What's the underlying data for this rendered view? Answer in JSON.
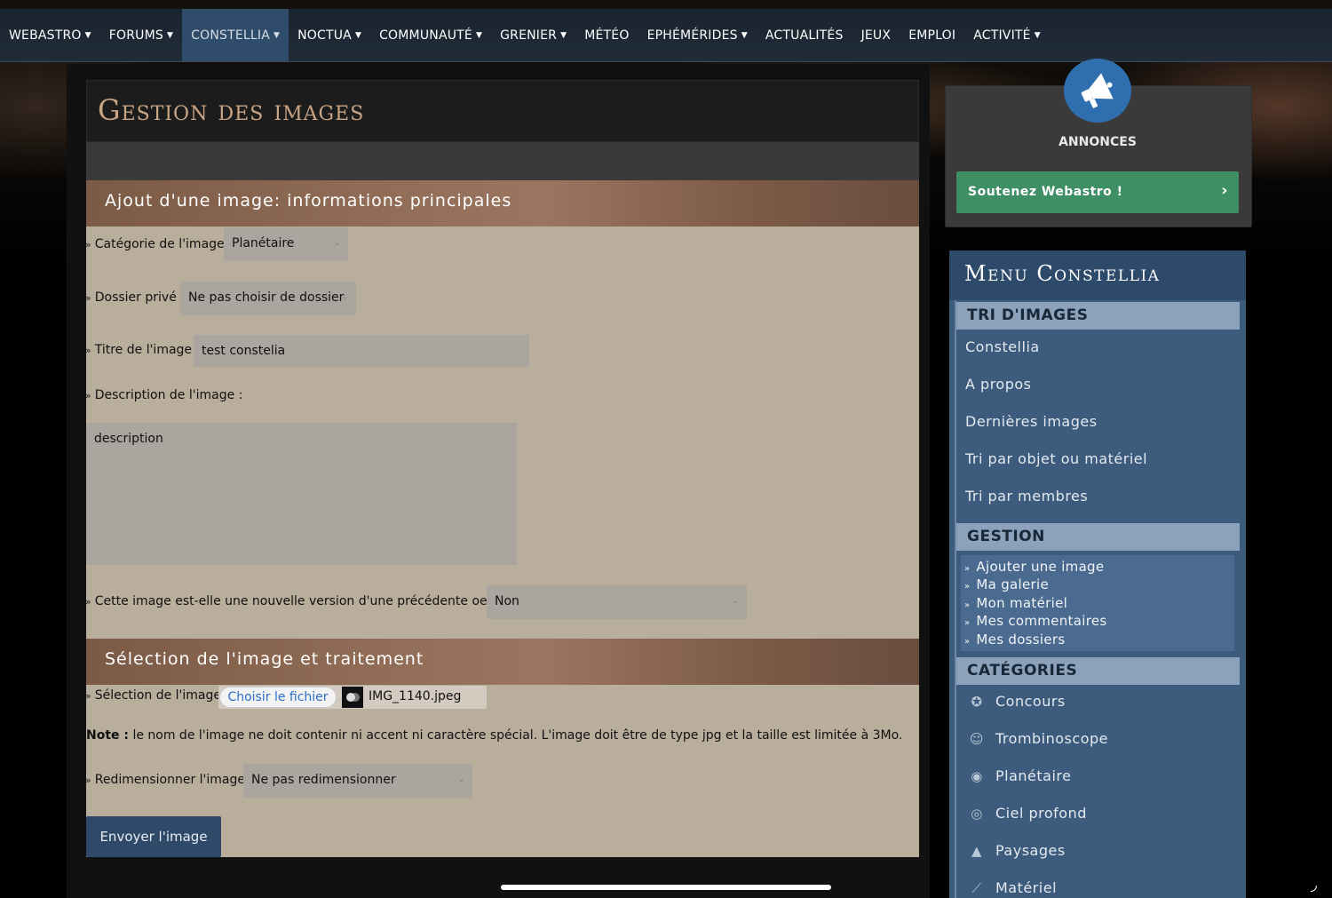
{
  "nav": {
    "items": [
      {
        "label": "WEBASTRO",
        "caret": true
      },
      {
        "label": "FORUMS",
        "caret": true
      },
      {
        "label": "CONSTELLIA",
        "caret": true,
        "active": true
      },
      {
        "label": "NOCTUA",
        "caret": true
      },
      {
        "label": "COMMUNAUTÉ",
        "caret": true
      },
      {
        "label": "GRENIER",
        "caret": true
      },
      {
        "label": "MÉTÉO",
        "caret": false
      },
      {
        "label": "EPHÉMÉRIDES",
        "caret": true
      },
      {
        "label": "ACTUALITÉS",
        "caret": false
      },
      {
        "label": "JEUX",
        "caret": false
      },
      {
        "label": "EMPLOI",
        "caret": false
      },
      {
        "label": "ACTIVITÉ",
        "caret": true
      }
    ]
  },
  "page": {
    "title": "Gestion des images"
  },
  "form": {
    "section1_title": "Ajout d'une image: informations principales",
    "category_label": "Catégorie de l'image :",
    "category_value": "Planétaire",
    "folder_label": "Dossier privé :",
    "folder_value": "Ne pas choisir de dossier",
    "title_label": "Titre de l'image :",
    "title_value": "test constelia",
    "description_label": "Description de l'image :",
    "description_value": "description",
    "new_version_label": "Cette image est-elle une nouvelle version d'une précédente oeuvre ?",
    "new_version_value": "Non",
    "section2_title": "Sélection de l'image et traitement",
    "file_label": "Sélection de l'image :",
    "file_button": "Choisir le fichier",
    "file_name": "IMG_1140.jpeg",
    "note_bold": "Note :",
    "note_text": " le nom de l'image ne doit contenir ni accent ni caractère spécial. L'image doit être de type jpg et la taille est limitée à 3Mo.",
    "resize_label": "Redimensionner l'image :",
    "resize_value": "Ne pas redimensionner",
    "submit_label": "Envoyer l'image"
  },
  "sidebar": {
    "announce_label": "ANNONCES",
    "support_label": "Soutenez Webastro !",
    "menu_title": "Menu Constellia",
    "tri_title": "TRI D'IMAGES",
    "tri_links": [
      "Constellia",
      "A propos",
      "Dernières images",
      "Tri par objet ou matériel",
      "Tri par membres"
    ],
    "gestion_title": "GESTION",
    "gestion_links": [
      "Ajouter une image",
      "Ma galerie",
      "Mon matériel",
      "Mes commentaires",
      "Mes dossiers"
    ],
    "categories_title": "CATÉGORIES",
    "categories": [
      {
        "label": "Concours",
        "icon": "award-icon"
      },
      {
        "label": "Trombinoscope",
        "icon": "portrait-icon"
      },
      {
        "label": "Planétaire",
        "icon": "planet-icon"
      },
      {
        "label": "Ciel profond",
        "icon": "galaxy-icon"
      },
      {
        "label": "Paysages",
        "icon": "landscape-icon"
      },
      {
        "label": "Matériel",
        "icon": "telescope-icon"
      }
    ]
  },
  "colors": {
    "nav_active": "#2f4d6a",
    "section_header": "#8e6a54",
    "form_background": "#b9ad9c",
    "support_green": "#3e8f63",
    "menu_blue": "#3d5b7c"
  }
}
